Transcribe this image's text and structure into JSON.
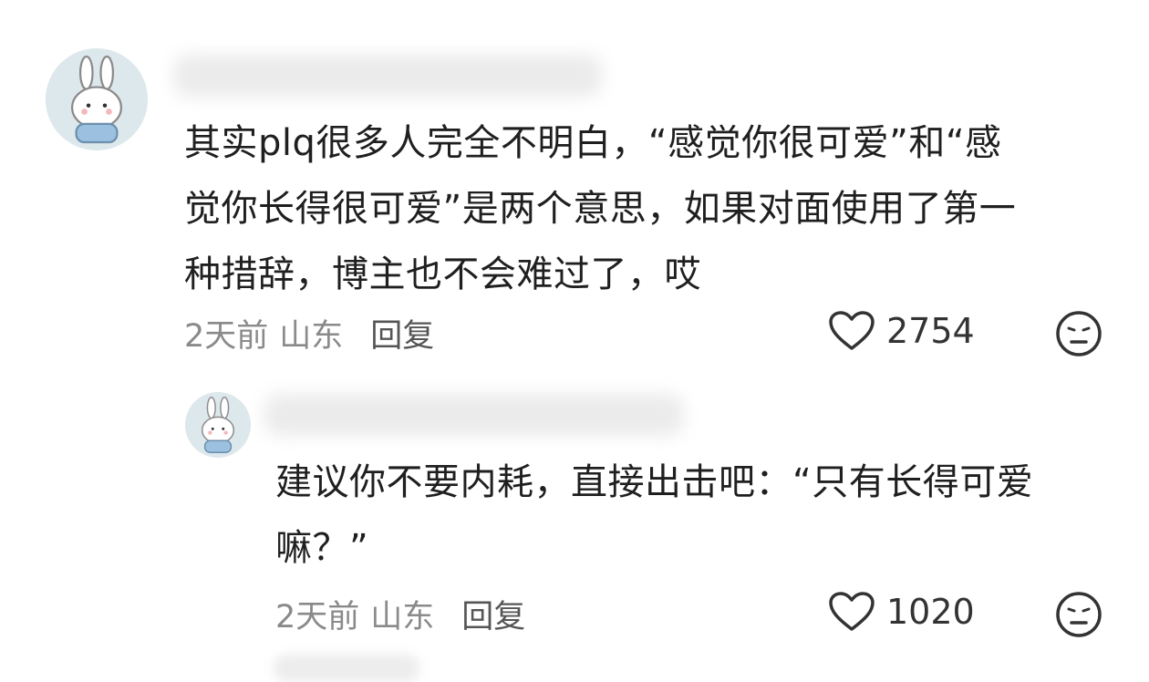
{
  "comments": [
    {
      "text_lines": [
        "其实plq很多人完全不明白，“感觉你很可爱”和“感",
        "觉你长得很可爱”是两个意思，如果对面使用了第一",
        "种措辞，博主也不会难过了，哎"
      ],
      "time": "2天前",
      "location": "山东",
      "reply_label": "回复",
      "likes": "2754"
    },
    {
      "text_lines": [
        "建议你不要内耗，直接出击吧：“只有长得可爱",
        "嘛？”"
      ],
      "time": "2天前",
      "location": "山东",
      "reply_label": "回复",
      "likes": "1020"
    }
  ],
  "icons": {
    "avatar": "bunny-astronaut-avatar-icon",
    "like": "heart-outline-icon",
    "dislike": "neutral-face-icon"
  },
  "colors": {
    "meta_text": "#8a8a8a",
    "body_text": "#1f1f1f",
    "avatar_bg": "#dfe9ec"
  }
}
